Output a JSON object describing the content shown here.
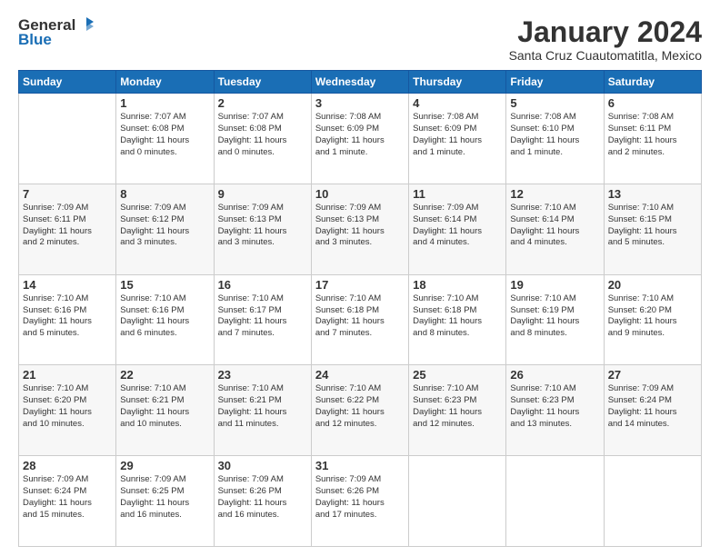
{
  "header": {
    "logo": {
      "general": "General",
      "blue": "Blue",
      "tagline": "Blue"
    },
    "title": "January 2024",
    "location": "Santa Cruz Cuautomatitla, Mexico"
  },
  "days_of_week": [
    "Sunday",
    "Monday",
    "Tuesday",
    "Wednesday",
    "Thursday",
    "Friday",
    "Saturday"
  ],
  "weeks": [
    [
      {
        "day": "",
        "info": ""
      },
      {
        "day": "1",
        "info": "Sunrise: 7:07 AM\nSunset: 6:08 PM\nDaylight: 11 hours\nand 0 minutes."
      },
      {
        "day": "2",
        "info": "Sunrise: 7:07 AM\nSunset: 6:08 PM\nDaylight: 11 hours\nand 0 minutes."
      },
      {
        "day": "3",
        "info": "Sunrise: 7:08 AM\nSunset: 6:09 PM\nDaylight: 11 hours\nand 1 minute."
      },
      {
        "day": "4",
        "info": "Sunrise: 7:08 AM\nSunset: 6:09 PM\nDaylight: 11 hours\nand 1 minute."
      },
      {
        "day": "5",
        "info": "Sunrise: 7:08 AM\nSunset: 6:10 PM\nDaylight: 11 hours\nand 1 minute."
      },
      {
        "day": "6",
        "info": "Sunrise: 7:08 AM\nSunset: 6:11 PM\nDaylight: 11 hours\nand 2 minutes."
      }
    ],
    [
      {
        "day": "7",
        "info": "Sunrise: 7:09 AM\nSunset: 6:11 PM\nDaylight: 11 hours\nand 2 minutes."
      },
      {
        "day": "8",
        "info": "Sunrise: 7:09 AM\nSunset: 6:12 PM\nDaylight: 11 hours\nand 3 minutes."
      },
      {
        "day": "9",
        "info": "Sunrise: 7:09 AM\nSunset: 6:13 PM\nDaylight: 11 hours\nand 3 minutes."
      },
      {
        "day": "10",
        "info": "Sunrise: 7:09 AM\nSunset: 6:13 PM\nDaylight: 11 hours\nand 3 minutes."
      },
      {
        "day": "11",
        "info": "Sunrise: 7:09 AM\nSunset: 6:14 PM\nDaylight: 11 hours\nand 4 minutes."
      },
      {
        "day": "12",
        "info": "Sunrise: 7:10 AM\nSunset: 6:14 PM\nDaylight: 11 hours\nand 4 minutes."
      },
      {
        "day": "13",
        "info": "Sunrise: 7:10 AM\nSunset: 6:15 PM\nDaylight: 11 hours\nand 5 minutes."
      }
    ],
    [
      {
        "day": "14",
        "info": "Sunrise: 7:10 AM\nSunset: 6:16 PM\nDaylight: 11 hours\nand 5 minutes."
      },
      {
        "day": "15",
        "info": "Sunrise: 7:10 AM\nSunset: 6:16 PM\nDaylight: 11 hours\nand 6 minutes."
      },
      {
        "day": "16",
        "info": "Sunrise: 7:10 AM\nSunset: 6:17 PM\nDaylight: 11 hours\nand 7 minutes."
      },
      {
        "day": "17",
        "info": "Sunrise: 7:10 AM\nSunset: 6:18 PM\nDaylight: 11 hours\nand 7 minutes."
      },
      {
        "day": "18",
        "info": "Sunrise: 7:10 AM\nSunset: 6:18 PM\nDaylight: 11 hours\nand 8 minutes."
      },
      {
        "day": "19",
        "info": "Sunrise: 7:10 AM\nSunset: 6:19 PM\nDaylight: 11 hours\nand 8 minutes."
      },
      {
        "day": "20",
        "info": "Sunrise: 7:10 AM\nSunset: 6:20 PM\nDaylight: 11 hours\nand 9 minutes."
      }
    ],
    [
      {
        "day": "21",
        "info": "Sunrise: 7:10 AM\nSunset: 6:20 PM\nDaylight: 11 hours\nand 10 minutes."
      },
      {
        "day": "22",
        "info": "Sunrise: 7:10 AM\nSunset: 6:21 PM\nDaylight: 11 hours\nand 10 minutes."
      },
      {
        "day": "23",
        "info": "Sunrise: 7:10 AM\nSunset: 6:21 PM\nDaylight: 11 hours\nand 11 minutes."
      },
      {
        "day": "24",
        "info": "Sunrise: 7:10 AM\nSunset: 6:22 PM\nDaylight: 11 hours\nand 12 minutes."
      },
      {
        "day": "25",
        "info": "Sunrise: 7:10 AM\nSunset: 6:23 PM\nDaylight: 11 hours\nand 12 minutes."
      },
      {
        "day": "26",
        "info": "Sunrise: 7:10 AM\nSunset: 6:23 PM\nDaylight: 11 hours\nand 13 minutes."
      },
      {
        "day": "27",
        "info": "Sunrise: 7:09 AM\nSunset: 6:24 PM\nDaylight: 11 hours\nand 14 minutes."
      }
    ],
    [
      {
        "day": "28",
        "info": "Sunrise: 7:09 AM\nSunset: 6:24 PM\nDaylight: 11 hours\nand 15 minutes."
      },
      {
        "day": "29",
        "info": "Sunrise: 7:09 AM\nSunset: 6:25 PM\nDaylight: 11 hours\nand 16 minutes."
      },
      {
        "day": "30",
        "info": "Sunrise: 7:09 AM\nSunset: 6:26 PM\nDaylight: 11 hours\nand 16 minutes."
      },
      {
        "day": "31",
        "info": "Sunrise: 7:09 AM\nSunset: 6:26 PM\nDaylight: 11 hours\nand 17 minutes."
      },
      {
        "day": "",
        "info": ""
      },
      {
        "day": "",
        "info": ""
      },
      {
        "day": "",
        "info": ""
      }
    ]
  ]
}
